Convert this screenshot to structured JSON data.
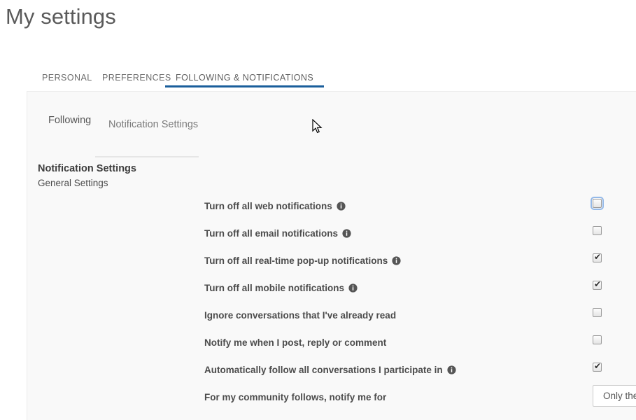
{
  "page": {
    "title": "My settings"
  },
  "tabs": [
    {
      "label": "PERSONAL",
      "active": false
    },
    {
      "label": "PREFERENCES",
      "active": false
    },
    {
      "label": "FOLLOWING & NOTIFICATIONS",
      "active": true
    }
  ],
  "subtabs": [
    {
      "label": "Following",
      "active": false
    },
    {
      "label": "Notification Settings",
      "active": true
    }
  ],
  "section": {
    "title": "Notification Settings",
    "subtitle": "General Settings"
  },
  "settings_rows": [
    {
      "label": "Turn off all web notifications",
      "has_info_icon": true,
      "control": "checkbox",
      "checked": false,
      "focused": true
    },
    {
      "label": "Turn off all email notifications",
      "has_info_icon": true,
      "control": "checkbox",
      "checked": false,
      "focused": false
    },
    {
      "label": "Turn off all real-time pop-up notifications",
      "has_info_icon": true,
      "control": "checkbox",
      "checked": true,
      "focused": false
    },
    {
      "label": "Turn off all mobile notifications",
      "has_info_icon": true,
      "control": "checkbox",
      "checked": true,
      "focused": false
    },
    {
      "label": "Ignore conversations that I've already read",
      "has_info_icon": false,
      "control": "checkbox",
      "checked": false,
      "focused": false
    },
    {
      "label": "Notify me when I post, reply or comment",
      "has_info_icon": false,
      "control": "checkbox",
      "checked": false,
      "focused": false
    },
    {
      "label": "Automatically follow all conversations I participate in",
      "has_info_icon": true,
      "control": "checkbox",
      "checked": true,
      "focused": false
    },
    {
      "label": "For my community follows, notify me for",
      "has_info_icon": false,
      "control": "select",
      "value": "Only the"
    }
  ],
  "icons": {
    "info": "info-circle-icon",
    "checkmark": "✔",
    "cursor": "mouse-arrow-cursor"
  },
  "colors": {
    "accent": "#1a5e9b",
    "panel_background": "#f9f9f9",
    "page_background": "#ffffff",
    "focus_ring": "#94b9e8",
    "text": "#4c4c4c"
  }
}
